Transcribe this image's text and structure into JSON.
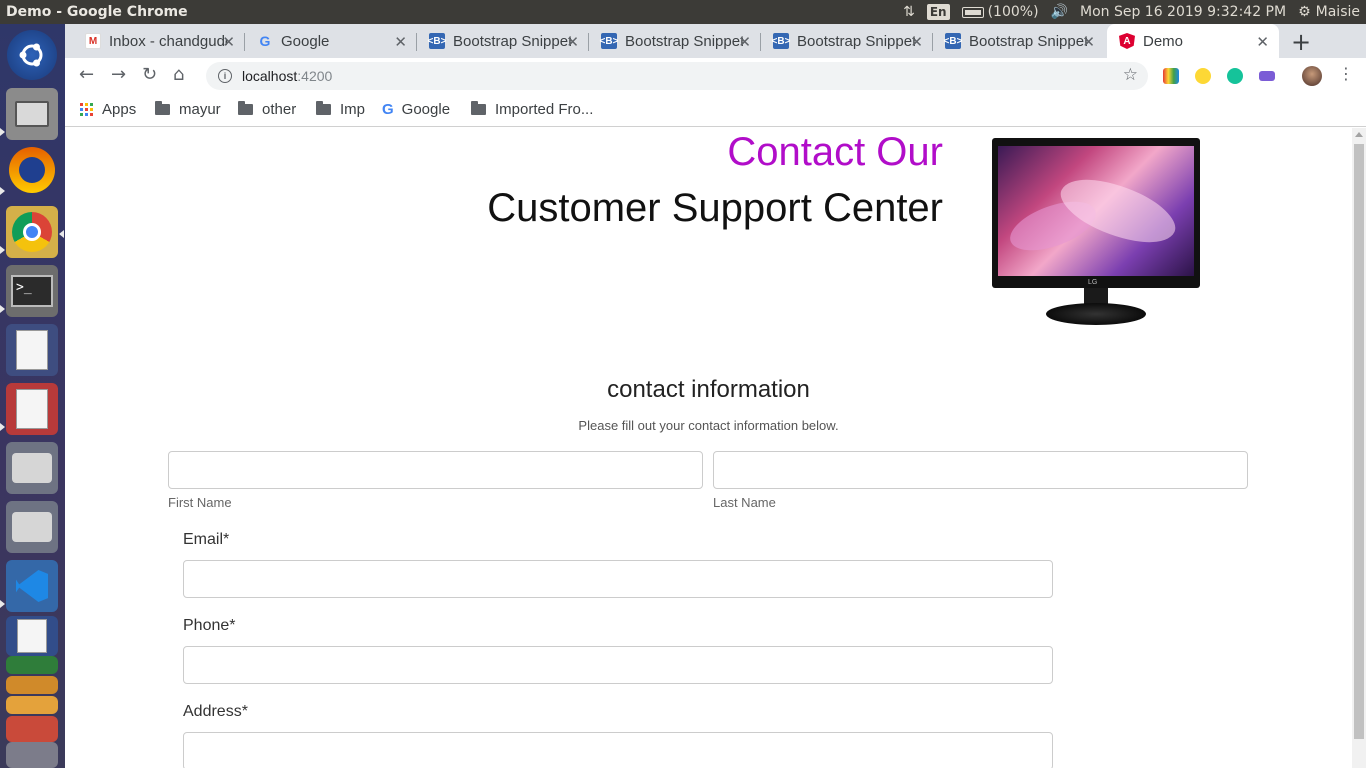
{
  "topbar": {
    "window_title": "Demo - Google Chrome",
    "lang": "En",
    "battery": "(100%)",
    "datetime": "Mon Sep 16 2019  9:32:42 PM",
    "user": "Maisie"
  },
  "tabs": [
    {
      "label": "Inbox - chandgude",
      "favicon": "gmail-icon",
      "active": false
    },
    {
      "label": "Google",
      "favicon": "google-icon",
      "active": false
    },
    {
      "label": "Bootstrap Snippets",
      "favicon": "bootstrap-icon",
      "active": false
    },
    {
      "label": "Bootstrap Snippets",
      "favicon": "bootstrap-icon",
      "active": false
    },
    {
      "label": "Bootstrap Snippets",
      "favicon": "bootstrap-icon",
      "active": false
    },
    {
      "label": "Bootstrap Snippets",
      "favicon": "bootstrap-icon",
      "active": false
    },
    {
      "label": "Demo",
      "favicon": "angular-icon",
      "active": true
    }
  ],
  "omnibox": {
    "host": "localhost",
    "port": ":4200"
  },
  "bookmarks": [
    {
      "label": "Apps",
      "icon": "apps-grid-icon"
    },
    {
      "label": "mayur",
      "icon": "folder-icon"
    },
    {
      "label": "other",
      "icon": "folder-icon"
    },
    {
      "label": "Imp",
      "icon": "folder-icon"
    },
    {
      "label": "Google",
      "icon": "google-icon"
    },
    {
      "label": "Imported Fro...",
      "icon": "folder-icon"
    }
  ],
  "page": {
    "heading_line1": "Contact Our",
    "heading_line2": "Customer Support Center",
    "section_title": "contact information",
    "section_subtitle": "Please fill out your contact information below.",
    "first_name_label": "First Name",
    "last_name_label": "Last Name",
    "email_label": "Email*",
    "phone_label": "Phone*",
    "address_label": "Address*",
    "first_name_value": "",
    "last_name_value": "",
    "email_value": "",
    "phone_value": "",
    "address_value": "",
    "monitor_brand": "LG"
  },
  "colors": {
    "accent_heading": "#b10dc9",
    "tabstrip": "#dee1e6",
    "panel": "#3c3b37"
  }
}
